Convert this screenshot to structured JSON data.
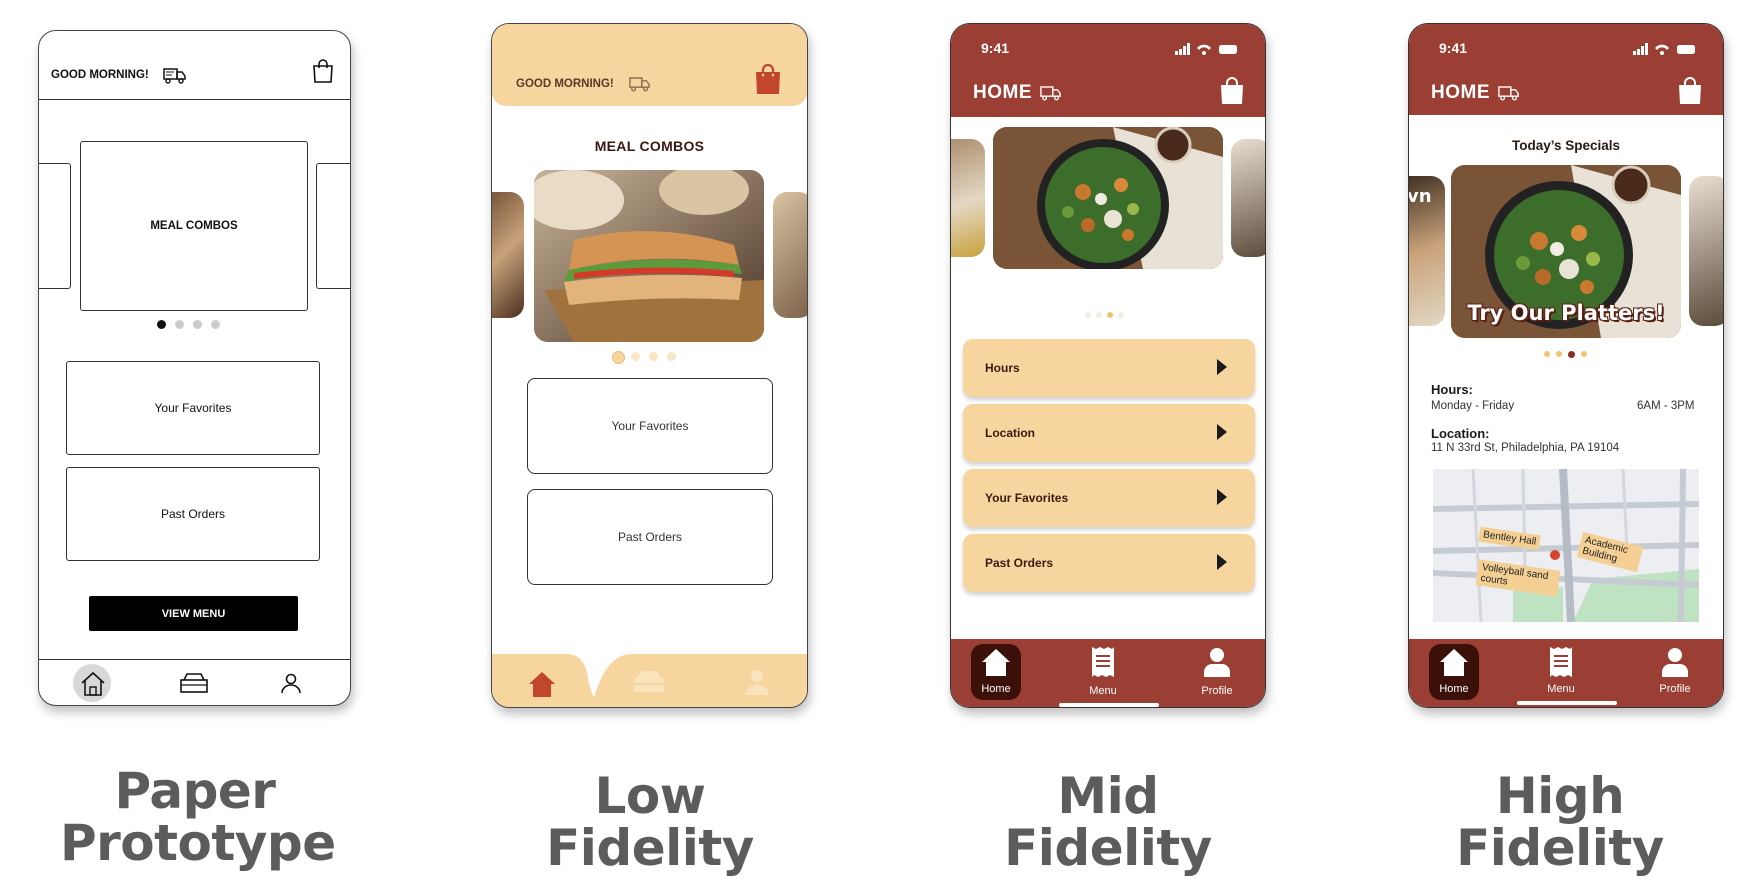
{
  "paper": {
    "greeting": "GOOD MORNING!",
    "carousel_label": "MEAL COMBOS",
    "favorites": "Your Favorites",
    "past_orders": "Past Orders",
    "view_menu": "VIEW MENU",
    "caption_line1": "Paper",
    "caption_line2": "Prototype"
  },
  "low": {
    "greeting": "GOOD MORNING!",
    "section_title": "MEAL COMBOS",
    "favorites": "Your Favorites",
    "past_orders": "Past Orders",
    "caption_line1": "Low",
    "caption_line2": "Fidelity"
  },
  "mid": {
    "time": "9:41",
    "header": "HOME",
    "rows": [
      "Hours",
      "Location",
      "Your Favorites",
      "Past Orders"
    ],
    "nav": [
      "Home",
      "Menu",
      "Profile"
    ],
    "caption_line1": "Mid",
    "caption_line2": "Fidelity"
  },
  "high": {
    "time": "9:41",
    "header": "HOME",
    "specials_title": "Today’s Specials",
    "banner_text": "Try Our Platters!",
    "side_text": "vn",
    "hours_label": "Hours:",
    "hours_days": "Monday - Friday",
    "hours_time": "6AM - 3PM",
    "location_label": "Location:",
    "address": "11 N 33rd St, Philadelphia, PA 19104",
    "map_labels": [
      "Bentley Hall",
      "Academic Building",
      "Volleyball sand courts"
    ],
    "nav": [
      "Home",
      "Menu",
      "Profile"
    ],
    "caption_line1": "High",
    "caption_line2": "Fidelity"
  },
  "colors": {
    "rust": "#9b3e33",
    "peach": "#f7d59f",
    "dark_rust": "#3a1008",
    "caption_gray": "#5c5c5c"
  }
}
